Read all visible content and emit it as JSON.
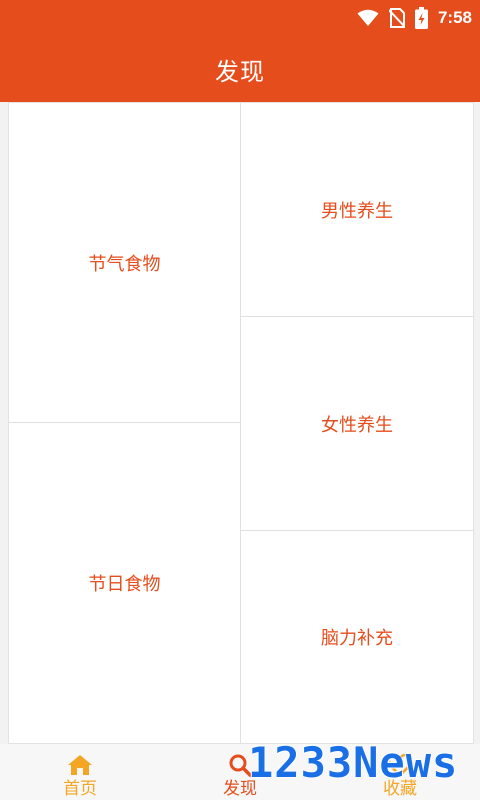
{
  "status_bar": {
    "time": "7:58",
    "icons": [
      "wifi-icon",
      "no-sim-icon",
      "battery-charging-icon"
    ]
  },
  "app_bar": {
    "title": "发现"
  },
  "grid": {
    "items": [
      {
        "label": "节气食物"
      },
      {
        "label": "节日食物"
      },
      {
        "label": "男性养生"
      },
      {
        "label": "女性养生"
      },
      {
        "label": "脑力补充"
      }
    ]
  },
  "bottom_nav": {
    "items": [
      {
        "label": "首页",
        "icon": "home-icon"
      },
      {
        "label": "发现",
        "icon": "search-icon"
      },
      {
        "label": "收藏",
        "icon": "heart-icon"
      }
    ],
    "active_color": "#f4a623"
  },
  "watermark": {
    "text": "1233News"
  },
  "colors": {
    "primary": "#e64d1c",
    "accent": "#f4a623"
  }
}
